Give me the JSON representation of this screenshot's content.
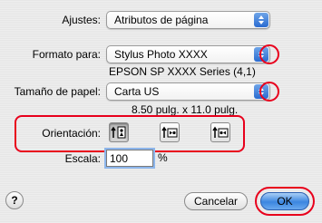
{
  "settings": {
    "label": "Ajustes:",
    "value": "Atributos de página"
  },
  "format": {
    "label": "Formato para:",
    "value": "Stylus Photo XXXX",
    "printer_info": "EPSON SP XXXX  Series (4,1)"
  },
  "paper": {
    "label": "Tamaño de papel:",
    "value": "Carta US",
    "dimensions": "8.50 pulg. x 11.0 pulg."
  },
  "orientation": {
    "label": "Orientación:",
    "selected": "portrait",
    "options": [
      "portrait",
      "landscape-left",
      "landscape-right"
    ]
  },
  "scale": {
    "label": "Escala:",
    "value": "100",
    "unit": "%"
  },
  "buttons": {
    "help": "?",
    "cancel": "Cancelar",
    "ok": "OK"
  },
  "colors": {
    "highlight_red": "#e8001c",
    "accent_blue": "#3b86e0"
  }
}
